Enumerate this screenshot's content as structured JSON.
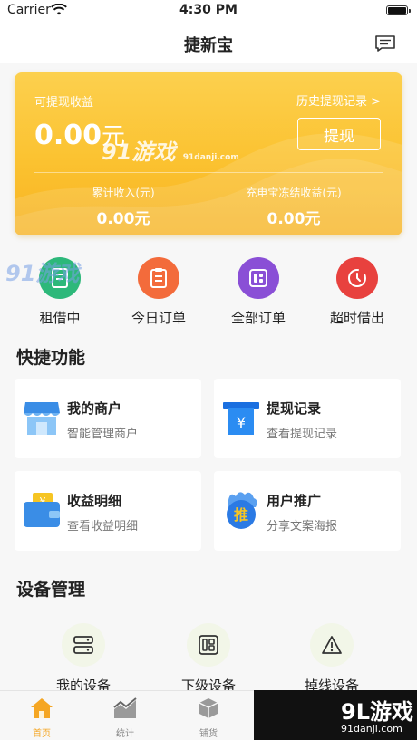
{
  "status_bar": {
    "carrier": "Carrier",
    "time": "4:30 PM"
  },
  "nav": {
    "title": "捷新宝"
  },
  "earnings": {
    "withdrawable_label": "可提现收益",
    "history_link": "历史提现记录 >",
    "amount": "0.00",
    "amount_unit": "元",
    "withdraw_button": "提现",
    "cumulative_label": "累计收入(元)",
    "cumulative_value": "0.00元",
    "frozen_label": "充电宝冻结收益(元)",
    "frozen_value": "0.00元"
  },
  "quick_actions": [
    {
      "label": "租借中",
      "icon": "device-icon",
      "color": "#2db87a"
    },
    {
      "label": "今日订单",
      "icon": "clipboard-icon",
      "color": "#f36b3b"
    },
    {
      "label": "全部订单",
      "icon": "grid-icon",
      "color": "#8a4fd6"
    },
    {
      "label": "超时借出",
      "icon": "clock-icon",
      "color": "#e8413e"
    }
  ],
  "shortcuts": {
    "title": "快捷功能",
    "cards": [
      {
        "title": "我的商户",
        "subtitle": "智能管理商户",
        "icon": "store-icon"
      },
      {
        "title": "提现记录",
        "subtitle": "查看提现记录",
        "icon": "withdraw-record-icon"
      },
      {
        "title": "收益明细",
        "subtitle": "查看收益明细",
        "icon": "wallet-icon"
      },
      {
        "title": "用户推广",
        "subtitle": "分享文案海报",
        "icon": "promote-icon",
        "badge": "推"
      }
    ]
  },
  "devices": {
    "title": "设备管理",
    "items": [
      {
        "label": "我的设备",
        "icon": "server-icon"
      },
      {
        "label": "下级设备",
        "icon": "devices-icon"
      },
      {
        "label": "掉线设备",
        "icon": "warning-icon"
      }
    ]
  },
  "tabs": [
    {
      "label": "首页",
      "icon": "home-icon",
      "active": true
    },
    {
      "label": "统计",
      "icon": "chart-icon",
      "active": false
    },
    {
      "label": "铺货",
      "icon": "box-icon",
      "active": false
    }
  ],
  "watermarks": {
    "logo_text": "9L游戏",
    "url": "91danji.com",
    "overlay_text": "91游戏"
  },
  "colors": {
    "accent": "#f5a623",
    "card_gradient_top": "#fcd04e",
    "card_gradient_bottom": "#f7b322"
  }
}
